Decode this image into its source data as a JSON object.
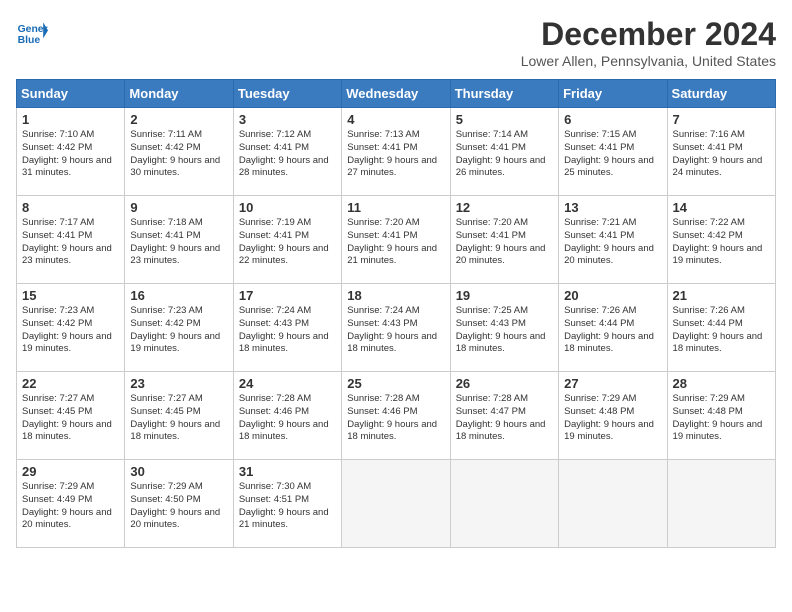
{
  "logo": {
    "line1": "General",
    "line2": "Blue"
  },
  "title": "December 2024",
  "subtitle": "Lower Allen, Pennsylvania, United States",
  "days_of_week": [
    "Sunday",
    "Monday",
    "Tuesday",
    "Wednesday",
    "Thursday",
    "Friday",
    "Saturday"
  ],
  "weeks": [
    [
      {
        "day": "1",
        "sunrise": "7:10 AM",
        "sunset": "4:42 PM",
        "daylight": "9 hours and 31 minutes."
      },
      {
        "day": "2",
        "sunrise": "7:11 AM",
        "sunset": "4:42 PM",
        "daylight": "9 hours and 30 minutes."
      },
      {
        "day": "3",
        "sunrise": "7:12 AM",
        "sunset": "4:41 PM",
        "daylight": "9 hours and 28 minutes."
      },
      {
        "day": "4",
        "sunrise": "7:13 AM",
        "sunset": "4:41 PM",
        "daylight": "9 hours and 27 minutes."
      },
      {
        "day": "5",
        "sunrise": "7:14 AM",
        "sunset": "4:41 PM",
        "daylight": "9 hours and 26 minutes."
      },
      {
        "day": "6",
        "sunrise": "7:15 AM",
        "sunset": "4:41 PM",
        "daylight": "9 hours and 25 minutes."
      },
      {
        "day": "7",
        "sunrise": "7:16 AM",
        "sunset": "4:41 PM",
        "daylight": "9 hours and 24 minutes."
      }
    ],
    [
      {
        "day": "8",
        "sunrise": "7:17 AM",
        "sunset": "4:41 PM",
        "daylight": "9 hours and 23 minutes."
      },
      {
        "day": "9",
        "sunrise": "7:18 AM",
        "sunset": "4:41 PM",
        "daylight": "9 hours and 23 minutes."
      },
      {
        "day": "10",
        "sunrise": "7:19 AM",
        "sunset": "4:41 PM",
        "daylight": "9 hours and 22 minutes."
      },
      {
        "day": "11",
        "sunrise": "7:20 AM",
        "sunset": "4:41 PM",
        "daylight": "9 hours and 21 minutes."
      },
      {
        "day": "12",
        "sunrise": "7:20 AM",
        "sunset": "4:41 PM",
        "daylight": "9 hours and 20 minutes."
      },
      {
        "day": "13",
        "sunrise": "7:21 AM",
        "sunset": "4:41 PM",
        "daylight": "9 hours and 20 minutes."
      },
      {
        "day": "14",
        "sunrise": "7:22 AM",
        "sunset": "4:42 PM",
        "daylight": "9 hours and 19 minutes."
      }
    ],
    [
      {
        "day": "15",
        "sunrise": "7:23 AM",
        "sunset": "4:42 PM",
        "daylight": "9 hours and 19 minutes."
      },
      {
        "day": "16",
        "sunrise": "7:23 AM",
        "sunset": "4:42 PM",
        "daylight": "9 hours and 19 minutes."
      },
      {
        "day": "17",
        "sunrise": "7:24 AM",
        "sunset": "4:43 PM",
        "daylight": "9 hours and 18 minutes."
      },
      {
        "day": "18",
        "sunrise": "7:24 AM",
        "sunset": "4:43 PM",
        "daylight": "9 hours and 18 minutes."
      },
      {
        "day": "19",
        "sunrise": "7:25 AM",
        "sunset": "4:43 PM",
        "daylight": "9 hours and 18 minutes."
      },
      {
        "day": "20",
        "sunrise": "7:26 AM",
        "sunset": "4:44 PM",
        "daylight": "9 hours and 18 minutes."
      },
      {
        "day": "21",
        "sunrise": "7:26 AM",
        "sunset": "4:44 PM",
        "daylight": "9 hours and 18 minutes."
      }
    ],
    [
      {
        "day": "22",
        "sunrise": "7:27 AM",
        "sunset": "4:45 PM",
        "daylight": "9 hours and 18 minutes."
      },
      {
        "day": "23",
        "sunrise": "7:27 AM",
        "sunset": "4:45 PM",
        "daylight": "9 hours and 18 minutes."
      },
      {
        "day": "24",
        "sunrise": "7:28 AM",
        "sunset": "4:46 PM",
        "daylight": "9 hours and 18 minutes."
      },
      {
        "day": "25",
        "sunrise": "7:28 AM",
        "sunset": "4:46 PM",
        "daylight": "9 hours and 18 minutes."
      },
      {
        "day": "26",
        "sunrise": "7:28 AM",
        "sunset": "4:47 PM",
        "daylight": "9 hours and 18 minutes."
      },
      {
        "day": "27",
        "sunrise": "7:29 AM",
        "sunset": "4:48 PM",
        "daylight": "9 hours and 19 minutes."
      },
      {
        "day": "28",
        "sunrise": "7:29 AM",
        "sunset": "4:48 PM",
        "daylight": "9 hours and 19 minutes."
      }
    ],
    [
      {
        "day": "29",
        "sunrise": "7:29 AM",
        "sunset": "4:49 PM",
        "daylight": "9 hours and 20 minutes."
      },
      {
        "day": "30",
        "sunrise": "7:29 AM",
        "sunset": "4:50 PM",
        "daylight": "9 hours and 20 minutes."
      },
      {
        "day": "31",
        "sunrise": "7:30 AM",
        "sunset": "4:51 PM",
        "daylight": "9 hours and 21 minutes."
      },
      null,
      null,
      null,
      null
    ]
  ]
}
